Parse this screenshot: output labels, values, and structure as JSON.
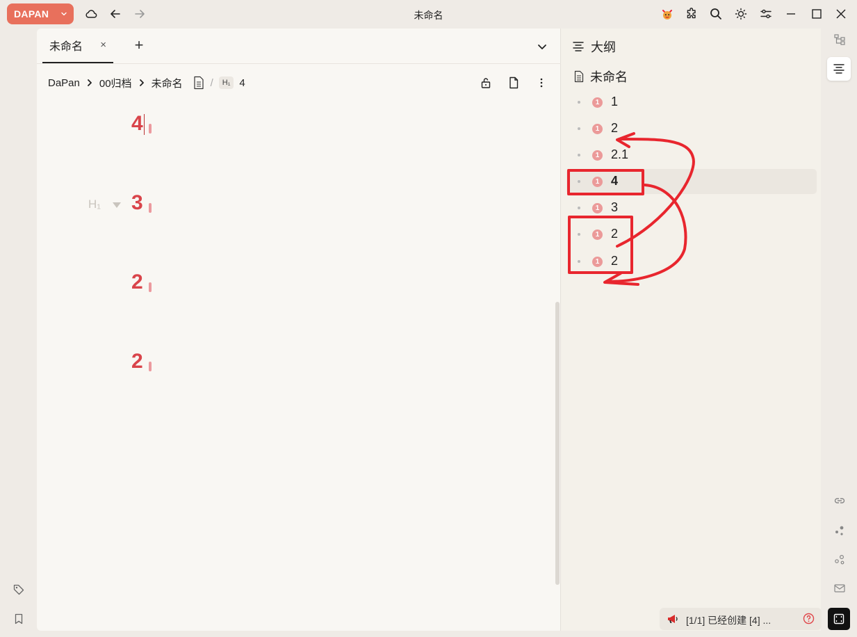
{
  "app": {
    "brand": "DAPAN",
    "window_title": "未命名"
  },
  "editor": {
    "tab_label": "未命名",
    "tab_close": "×",
    "tab_add": "+",
    "breadcrumb": {
      "root": "DaPan",
      "folder": "00归档",
      "doc": "未命名",
      "heading_badge": "H₁",
      "heading": "4"
    },
    "headings": [
      "4",
      "3",
      "2",
      "2"
    ],
    "heading_hint": "H₁"
  },
  "outline": {
    "title": "大纲",
    "doc_title": "未命名",
    "items": [
      {
        "label": "1",
        "badge": "1"
      },
      {
        "label": "2",
        "badge": "1"
      },
      {
        "label": "2.1",
        "badge": "1"
      },
      {
        "label": "4",
        "badge": "1",
        "active": true
      },
      {
        "label": "3",
        "badge": "1"
      },
      {
        "label": "2",
        "badge": "1"
      },
      {
        "label": "2",
        "badge": "1"
      }
    ]
  },
  "notification": {
    "text": "[1/1] 已经创建 [4] ..."
  },
  "colors": {
    "brand": "#e8705c",
    "heading": "#d9444a",
    "annotation": "#e8262e"
  }
}
